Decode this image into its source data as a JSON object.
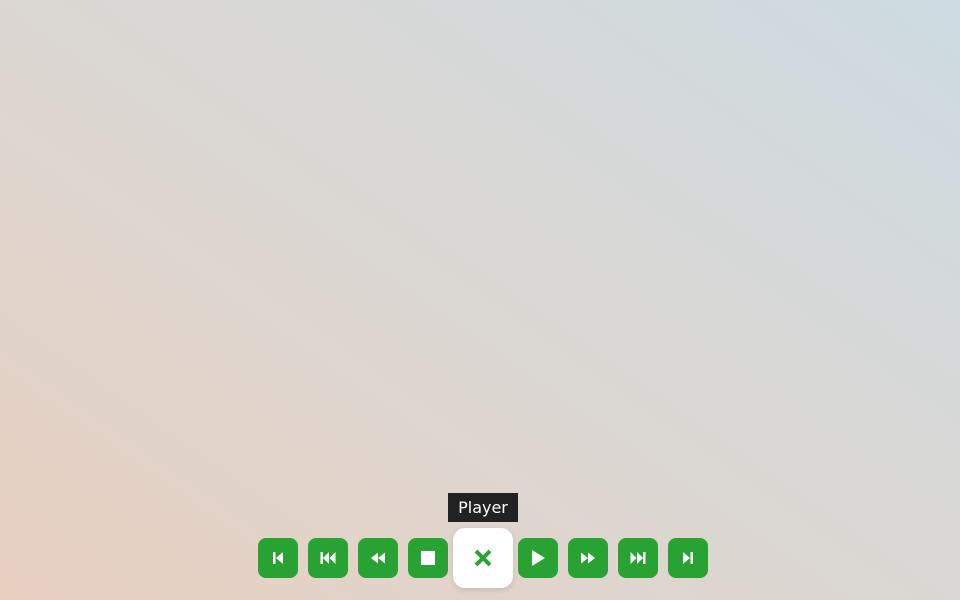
{
  "tooltip": {
    "text": "Player"
  },
  "controls": [
    {
      "name": "first",
      "icon": "skip-to-start-icon"
    },
    {
      "name": "previous",
      "icon": "skip-back-icon"
    },
    {
      "name": "rewind",
      "icon": "rewind-icon"
    },
    {
      "name": "stop",
      "icon": "stop-icon"
    },
    {
      "name": "close-player",
      "icon": "close-icon",
      "active": true
    },
    {
      "name": "play",
      "icon": "play-icon"
    },
    {
      "name": "fast-forward",
      "icon": "fast-forward-icon"
    },
    {
      "name": "next",
      "icon": "skip-forward-icon"
    },
    {
      "name": "last",
      "icon": "skip-to-end-icon"
    }
  ],
  "colors": {
    "button": "#28a232",
    "active_button": "#ffffff",
    "tooltip": "#222222"
  }
}
